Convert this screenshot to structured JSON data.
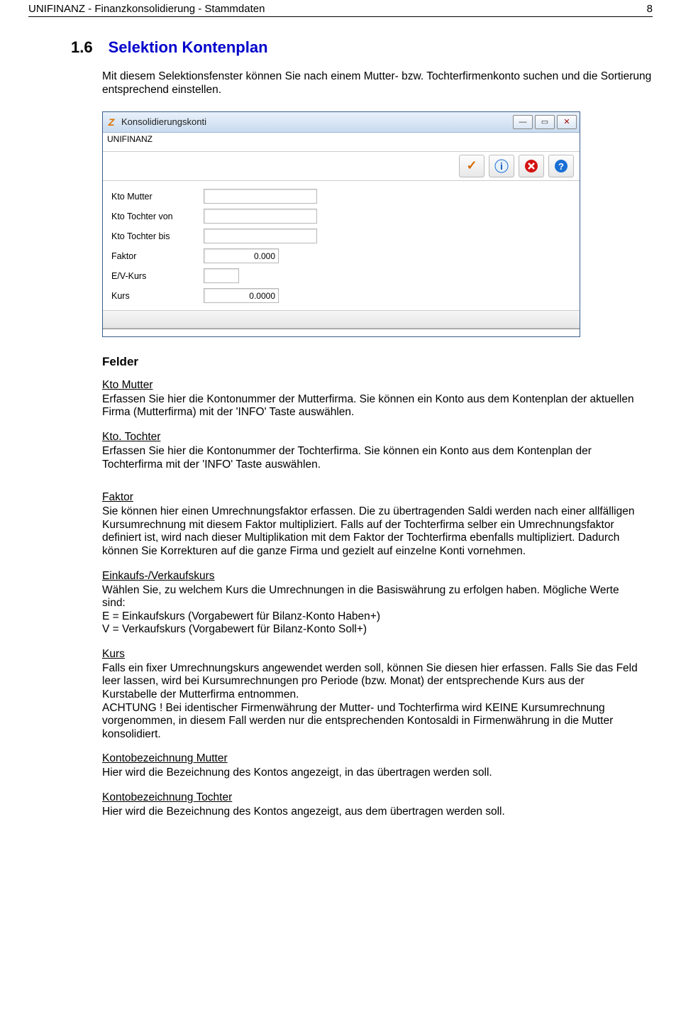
{
  "header": {
    "left": "UNIFINANZ - Finanzkonsolidierung - Stammdaten",
    "pagenum": "8"
  },
  "section": {
    "num": "1.6",
    "title": "Selektion Kontenplan"
  },
  "intro": "Mit diesem Selektionsfenster können Sie nach einem Mutter- bzw. Tochterfirmenkonto suchen und die Sortierung entsprechend einstellen.",
  "window": {
    "title": "Konsolidierungskonti",
    "subbar": "UNIFINANZ",
    "labels": {
      "kto_mutter": "Kto Mutter",
      "kto_tochter_von": "Kto Tochter von",
      "kto_tochter_bis": "Kto Tochter bis",
      "faktor": "Faktor",
      "evkurs": "E/V-Kurs",
      "kurs": "Kurs"
    },
    "values": {
      "kto_mutter": "",
      "kto_tochter_von": "",
      "kto_tochter_bis": "",
      "faktor": "0.000",
      "evkurs": "",
      "kurs": "0.0000"
    }
  },
  "felder_heading": "Felder",
  "fields": {
    "kto_mutter": {
      "title": "Kto Mutter",
      "text": "Erfassen Sie hier die Kontonummer der Mutterfirma. Sie können ein Konto aus dem Kontenplan der aktuellen Firma (Mutterfirma) mit der 'INFO' Taste auswählen."
    },
    "kto_tochter": {
      "title": "Kto. Tochter",
      "text": "Erfassen Sie hier die Kontonummer der Tochterfirma. Sie können ein Konto aus dem Kontenplan der Tochterfirma mit der 'INFO' Taste auswählen."
    },
    "faktor": {
      "title": "Faktor",
      "text": "Sie können hier einen Umrechnungsfaktor erfassen. Die zu übertragenden Saldi werden nach einer allfälligen Kursumrechnung mit diesem Faktor multipliziert. Falls auf der Tochterfirma selber ein Umrechnungsfaktor definiert ist, wird nach dieser Multiplikation mit dem Faktor der Tochterfirma ebenfalls multipliziert. Dadurch können Sie Korrekturen auf die ganze Firma und gezielt auf einzelne Konti vornehmen."
    },
    "ekvk": {
      "title": "Einkaufs-/Verkaufskurs",
      "text": "Wählen Sie, zu welchem Kurs die Umrechnungen in die Basiswährung zu erfolgen haben. Mögliche Werte sind:\nE = Einkaufskurs (Vorgabewert für Bilanz-Konto Haben+)\nV = Verkaufskurs (Vorgabewert für Bilanz-Konto Soll+)"
    },
    "kurs": {
      "title": "Kurs",
      "text": "Falls ein fixer Umrechnungskurs angewendet werden soll, können Sie diesen hier erfassen. Falls Sie das Feld leer lassen, wird bei Kursumrechnungen pro Periode (bzw. Monat) der entsprechende Kurs aus der Kurstabelle der Mutterfirma entnommen.\nACHTUNG ! Bei identischer Firmenwährung der Mutter- und Tochterfirma wird KEINE Kursumrechnung vorgenommen, in diesem Fall werden nur die entsprechenden Kontosaldi in Firmenwährung in die Mutter konsolidiert."
    },
    "kbez_mutter": {
      "title": "Kontobezeichnung Mutter",
      "text": "Hier wird die Bezeichnung des Kontos angezeigt, in das übertragen werden soll."
    },
    "kbez_tochter": {
      "title": "Kontobezeichnung Tochter",
      "text": "Hier wird die Bezeichnung des Kontos angezeigt, aus dem übertragen werden soll."
    }
  }
}
